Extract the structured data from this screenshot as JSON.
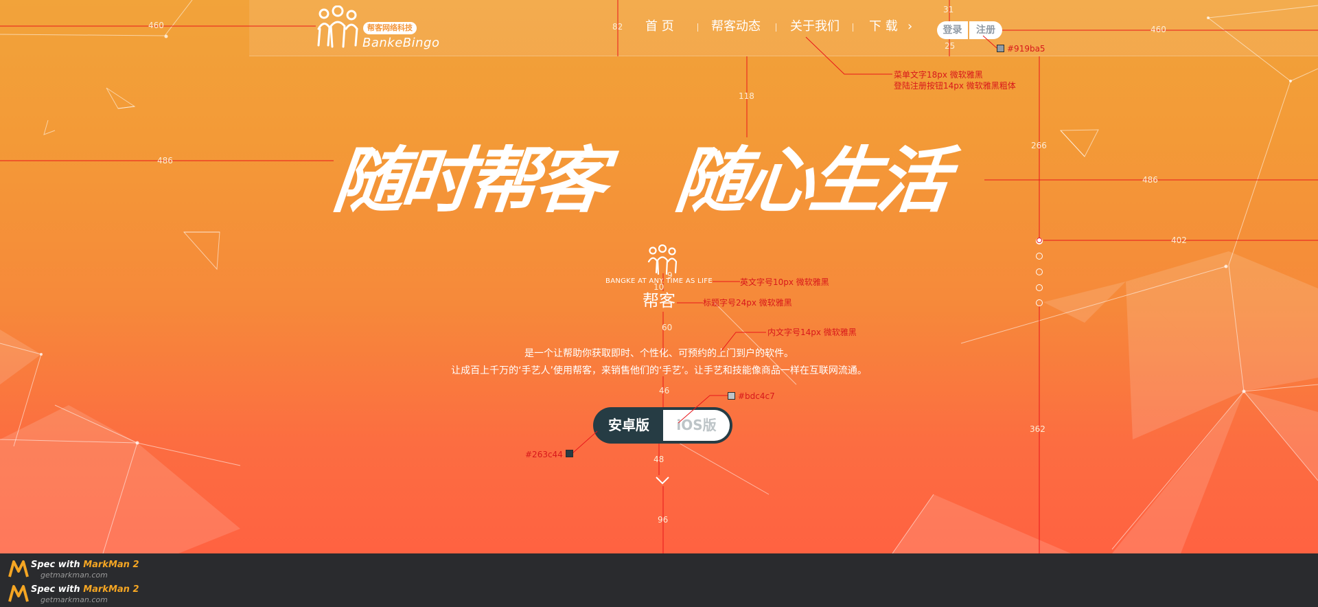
{
  "header": {
    "logo": {
      "cn_badge": "帮客网络科技",
      "en": "BankeBingo"
    },
    "nav": [
      {
        "label": "首 页"
      },
      {
        "label": "帮客动态"
      },
      {
        "label": "关于我们"
      },
      {
        "label": "下 载"
      }
    ],
    "nav_chevron": "›",
    "login_label": "登录",
    "register_label": "注册"
  },
  "hero": {
    "slogan_left": "随时帮客",
    "slogan_right": "随心生活",
    "en_subtitle": "BANGKE AT ANY TIME AS LIFE",
    "title": "帮客",
    "description": [
      "是一个让帮助你获取即时、个性化、可预约的上门到户的软件。",
      "让成百上千万的‘手艺人’使用帮客，来销售他们的‘手艺’。让手艺和技能像商品一样在互联网流通。"
    ],
    "download_android": "安卓版",
    "download_ios": "iOS版"
  },
  "pager": {
    "count": 5,
    "active_index": 0
  },
  "annotations": {
    "dims": [
      "460",
      "82",
      "31",
      "25",
      "460",
      "118",
      "486",
      "266",
      "486",
      "402",
      "9",
      "10",
      "60",
      "46",
      "48",
      "96",
      "362"
    ],
    "notes": {
      "menu_font": "菜单文字18px 微软雅黑",
      "login_font": "登陆注册按钮14px 微软雅黑粗体",
      "en_font": "英文字号10px 微软雅黑",
      "title_font": "标题字号24px 微软雅黑",
      "body_font": "内文字号14px 微软雅黑"
    },
    "colors": {
      "login_text": "#919ba5",
      "ios_text": "#bdc4c7",
      "android_bg": "#263c44"
    }
  },
  "footer": {
    "markman": [
      {
        "line1_prefix": "Spec with ",
        "line1_brand": "MarkMan 2",
        "line2": "getmarkman.com"
      },
      {
        "line1_prefix": "Spec with ",
        "line1_brand": "MarkMan 2",
        "line2": "getmarkman.com"
      }
    ]
  }
}
